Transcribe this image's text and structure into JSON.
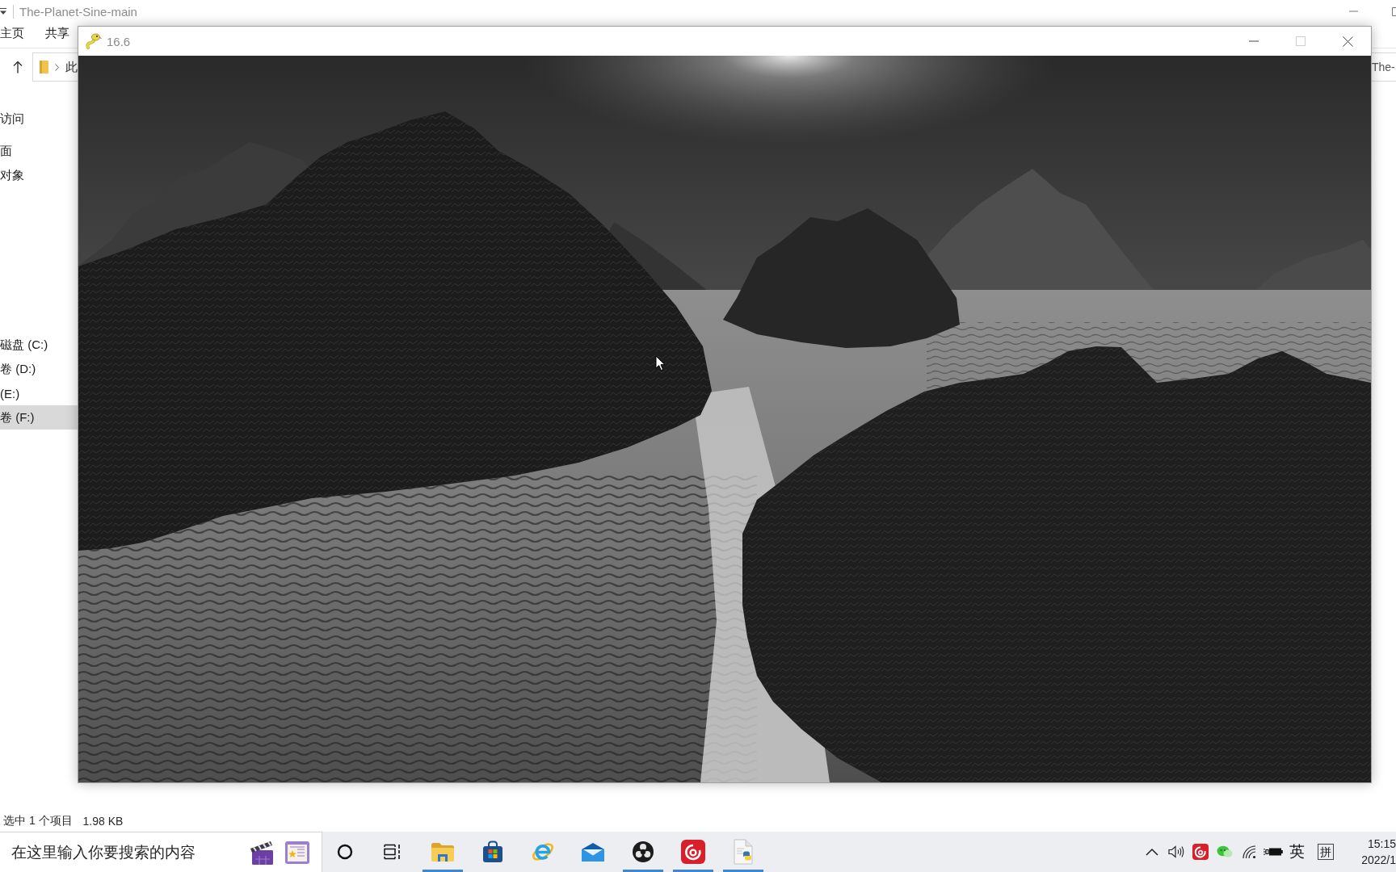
{
  "explorer": {
    "title": "The-Planet-Sine-main",
    "ribbon_tabs": [
      {
        "label": "主页",
        "selected": false
      },
      {
        "label": "共享",
        "selected": false
      }
    ],
    "address": {
      "crumb": "此"
    },
    "right_field": {
      "text": "The-"
    },
    "nav_quick": [
      {
        "label": "访问",
        "selected": false
      },
      {
        "label": "面",
        "selected": false
      },
      {
        "label": "对象",
        "selected": false
      }
    ],
    "nav_drives": [
      {
        "label": "磁盘 (C:)",
        "selected": false
      },
      {
        "label": "卷 (D:)",
        "selected": false
      },
      {
        "label": "(E:)",
        "selected": false
      },
      {
        "label": "卷 (F:)",
        "selected": true
      }
    ],
    "status_bar": {
      "selection": "选中 1 个项目",
      "size": "1.98 KB"
    }
  },
  "game_window": {
    "title": "16.6",
    "buttons": [
      {
        "kind": "minimize",
        "disabled": false
      },
      {
        "kind": "maximize",
        "disabled": true
      },
      {
        "kind": "close",
        "disabled": false
      }
    ]
  },
  "taskbar": {
    "search": {
      "placeholder": "在这里输入你要搜索的内容"
    },
    "apps": [
      {
        "kind": "folder",
        "running": true
      },
      {
        "kind": "bag",
        "running": false
      },
      {
        "kind": "e-ring",
        "running": false
      },
      {
        "kind": "envelope",
        "running": false
      },
      {
        "kind": "disc",
        "running": true
      },
      {
        "kind": "spiral",
        "running": true
      },
      {
        "kind": "document",
        "running": true
      }
    ],
    "tray": {
      "input_mode": "英",
      "ime": "拼"
    },
    "clock": {
      "time": "15:15",
      "date": "2022/1"
    }
  }
}
